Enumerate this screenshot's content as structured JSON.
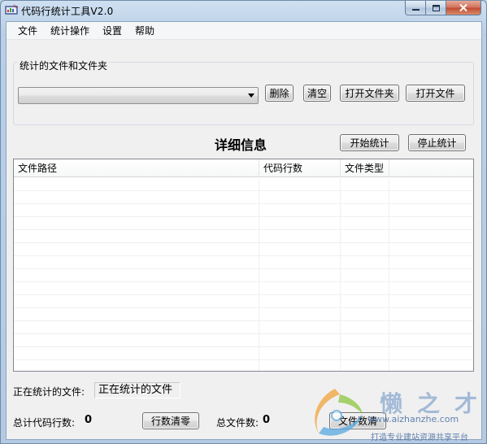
{
  "window": {
    "title": "代码行统计工具V2.0"
  },
  "menu": {
    "items": [
      "文件",
      "统计操作",
      "设置",
      "帮助"
    ]
  },
  "source_group": {
    "label": "统计的文件和文件夹",
    "combo_value": "",
    "buttons": {
      "delete": "删除",
      "clear": "清空",
      "open_folder": "打开文件夹",
      "open_file": "打开文件"
    }
  },
  "details": {
    "title": "详细信息",
    "start_label": "开始统计",
    "stop_label": "停止统计"
  },
  "table": {
    "columns": [
      "文件路径",
      "代码行数",
      "文件类型"
    ],
    "rows": []
  },
  "status": {
    "current_file_label": "正在统计的文件:",
    "current_file_value": "正在统计的文件",
    "total_lines_label": "总计代码行数:",
    "total_lines_value": "0",
    "reset_lines_label": "行数清零",
    "total_files_label": "总文件数:",
    "total_files_value": "0",
    "reset_files_label": "文件数清"
  },
  "watermark": {
    "logo_text": "懒之才",
    "url": "www.aizhanzhe.com",
    "slogan": "打造专业建站资源共享平台"
  },
  "colors": {
    "titlebar": "#b9cfe7",
    "client_bg": "#f0f0f0",
    "close_button": "#c14a2f",
    "watermark_blue": "#2f5d9a"
  },
  "icons": {
    "app": "bar-chart-window-icon",
    "minimize": "minimize-icon",
    "maximize": "maximize-icon",
    "close": "close-icon",
    "dropdown": "chevron-down-icon"
  }
}
